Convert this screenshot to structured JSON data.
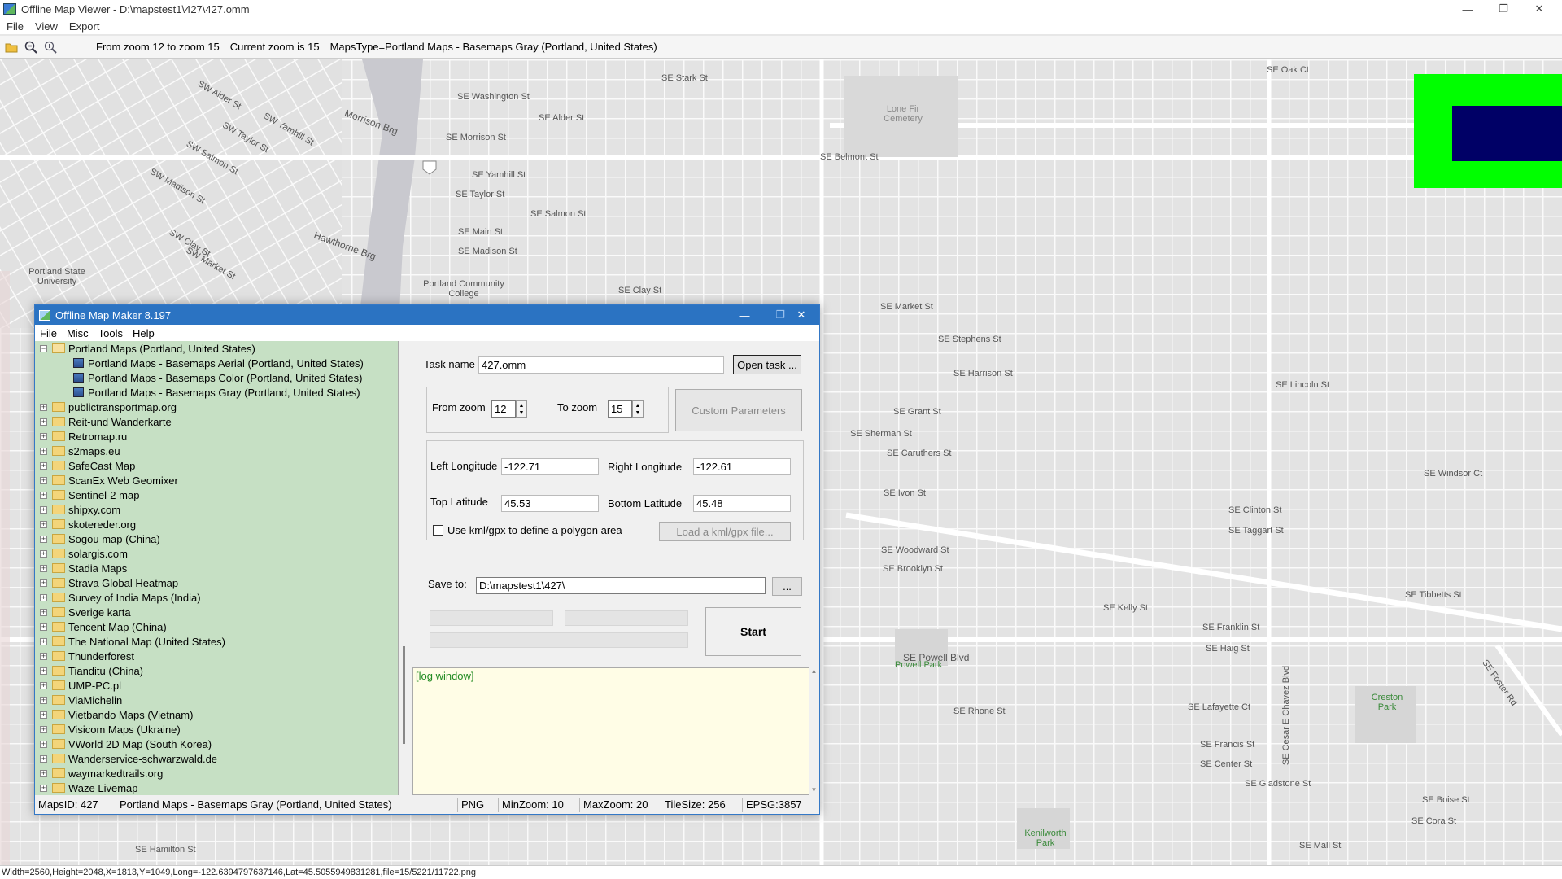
{
  "app": {
    "title": "Offline Map Viewer - D:\\mapstest1\\427\\427.omm",
    "window_controls": {
      "minimize": "—",
      "maximize": "❐",
      "close": "✕"
    }
  },
  "menu": [
    "File",
    "View",
    "Export"
  ],
  "toolbar": {
    "icons": [
      "open-folder-icon",
      "zoom-out-icon",
      "zoom-in-icon"
    ],
    "zoom_range": "From zoom 12 to zoom 15",
    "current_zoom": "Current zoom is 15",
    "maps_type": "MapsType=Portland Maps - Basemaps Gray (Portland, United States)"
  },
  "map": {
    "labels": [
      "SE Stark St",
      "SE Washington St",
      "SE Alder St",
      "SE Morrison St",
      "SE Belmont St",
      "SE Yamhill St",
      "SE Taylor St",
      "SE Salmon St",
      "SE Main St",
      "SE Madison St",
      "SE Clay St",
      "SE Market St",
      "SE Stephens St",
      "SE Harrison St",
      "SE Lincoln St",
      "SE Grant St",
      "SE Sherman St",
      "SE Caruthers St",
      "SE Ivon St",
      "SE Woodward St",
      "SE Brooklyn St",
      "SE Tibbetts St",
      "SE Kelly St",
      "SE Franklin St",
      "SE Haig St",
      "SE Powell Blvd",
      "SE Rhone St",
      "SE Francis St",
      "SE Center St",
      "SE Gladstone St",
      "SE Cora St",
      "SE Mall St",
      "SE Oak Ct",
      "SE Windsor Ct",
      "SE Clinton St",
      "SE Taggart St",
      "SE Boise St",
      "SE Hamilton St",
      "SW Alder St",
      "Morrison Brg",
      "Hawthorne Brg",
      "Portland State University",
      "Portland Community College",
      "Lone Fir Cemetery",
      "Powell Park",
      "Creston Park",
      "Kenilworth Park",
      "SE Lafayette Ct",
      "SE Cesar E Chavez Blvd",
      "SE Foster Rd",
      "SW Market St",
      "SW Clay St",
      "SW Madison St",
      "SW Salmon St",
      "SW Taylor St",
      "SW Yamhill St"
    ],
    "legend_box_colors": {
      "outer": "#00ff00",
      "inner": "#000066"
    }
  },
  "dialog": {
    "title": "Offline Map Maker 8.197",
    "menu": [
      "File",
      "Misc",
      "Tools",
      "Help"
    ],
    "tree": {
      "expanded": {
        "label": "Portland Maps (Portland, United States)",
        "children": [
          "Portland Maps - Basemaps Aerial (Portland, United States)",
          "Portland Maps - Basemaps Color (Portland, United States)",
          "Portland Maps - Basemaps Gray (Portland, United States)"
        ]
      },
      "items": [
        "publictransportmap.org",
        "Reit-und Wanderkarte",
        "Retromap.ru",
        "s2maps.eu",
        "SafeCast Map",
        "ScanEx Web Geomixer",
        "Sentinel-2 map",
        "shipxy.com",
        "skotereder.org",
        "Sogou map (China)",
        "solargis.com",
        "Stadia Maps",
        "Strava Global Heatmap",
        "Survey of India Maps (India)",
        "Sverige karta",
        "Tencent Map (China)",
        "The National Map (United States)",
        "Thunderforest",
        "Tianditu (China)",
        "UMP-PC.pl",
        "ViaMichelin",
        "Vietbando Maps (Vietnam)",
        "Visicom Maps (Ukraine)",
        "VWorld 2D Map (South Korea)",
        "Wanderservice-schwarzwald.de",
        "waymarkedtrails.org",
        "Waze Livemap"
      ]
    },
    "task_name_label": "Task name",
    "task_name_value": "427.omm",
    "open_task_button": "Open task ...",
    "from_zoom_label": "From zoom",
    "from_zoom_value": "12",
    "to_zoom_label": "To zoom",
    "to_zoom_value": "15",
    "custom_params_button": "Custom Parameters",
    "left_lon_label": "Left Longitude",
    "left_lon_value": "-122.71",
    "right_lon_label": "Right Longitude",
    "right_lon_value": "-122.61",
    "top_lat_label": "Top Latitude",
    "top_lat_value": "45.53",
    "bottom_lat_label": "Bottom Latitude",
    "bottom_lat_value": "45.48",
    "kml_checkbox_label": "Use kml/gpx to define a polygon area",
    "load_kml_button": "Load a kml/gpx file...",
    "save_to_label": "Save to:",
    "save_to_value": "D:\\mapstest1\\427\\",
    "browse_button": "...",
    "start_button": "Start",
    "log_text": "[log window]",
    "status": {
      "maps_id": "MapsID: 427",
      "map_name": "Portland Maps - Basemaps Gray (Portland, United States)",
      "format": "PNG",
      "min_zoom": "MinZoom: 10",
      "max_zoom": "MaxZoom: 20",
      "tile_size": "TileSize: 256",
      "epsg": "EPSG:3857"
    }
  },
  "statusbar": "Width=2560,Height=2048,X=1813,Y=1049,Long=-122.6394797637146,Lat=45.5055949831281,file=15/5221/11722.png"
}
